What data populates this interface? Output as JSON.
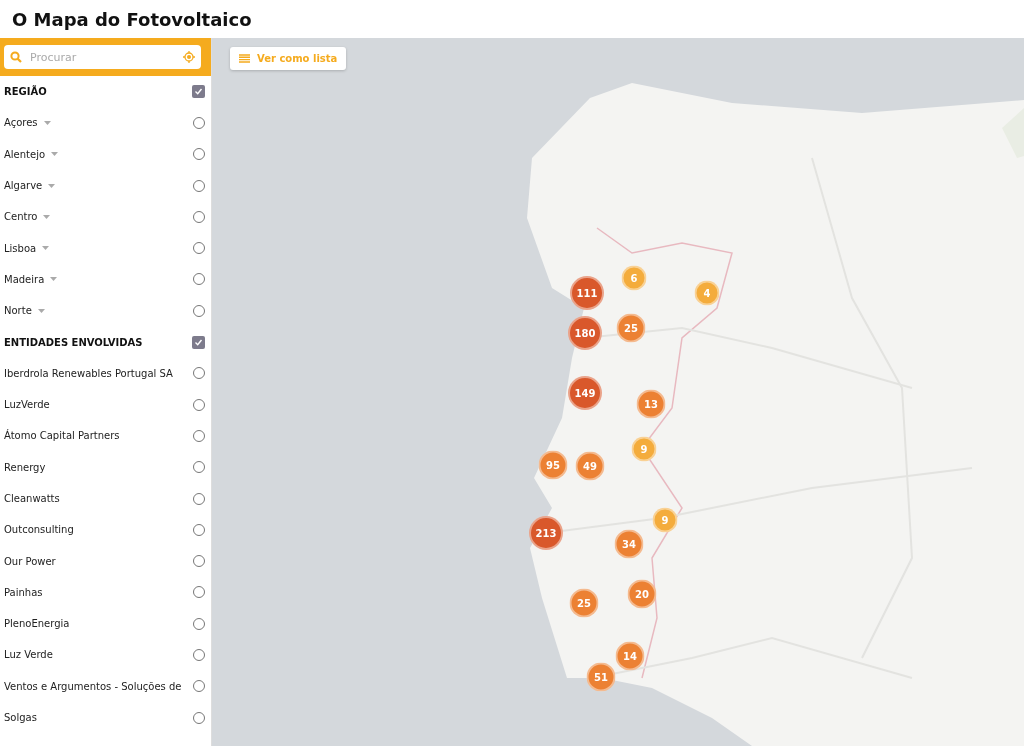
{
  "title": "O Mapa do Fotovoltaico",
  "search": {
    "placeholder": "Procurar"
  },
  "list_button": {
    "label": "Ver como lista"
  },
  "sections": [
    {
      "heading": "REGIÃO",
      "checked": true,
      "items": [
        {
          "label": "Açores",
          "expandable": true,
          "selected": false
        },
        {
          "label": "Alentejo",
          "expandable": true,
          "selected": false
        },
        {
          "label": "Algarve",
          "expandable": true,
          "selected": false
        },
        {
          "label": "Centro",
          "expandable": true,
          "selected": false
        },
        {
          "label": "Lisboa",
          "expandable": true,
          "selected": false
        },
        {
          "label": "Madeira",
          "expandable": true,
          "selected": false
        },
        {
          "label": "Norte",
          "expandable": true,
          "selected": false
        }
      ]
    },
    {
      "heading": "ENTIDADES ENVOLVIDAS",
      "checked": true,
      "items": [
        {
          "label": "Iberdrola Renewables Portugal SA",
          "expandable": false,
          "selected": false
        },
        {
          "label": "LuzVerde",
          "expandable": false,
          "selected": false
        },
        {
          "label": "Átomo Capital Partners",
          "expandable": false,
          "selected": false
        },
        {
          "label": "Renergy",
          "expandable": false,
          "selected": false
        },
        {
          "label": "Cleanwatts",
          "expandable": false,
          "selected": false
        },
        {
          "label": "Outconsulting",
          "expandable": false,
          "selected": false
        },
        {
          "label": "Our Power",
          "expandable": false,
          "selected": false
        },
        {
          "label": "Painhas",
          "expandable": false,
          "selected": false
        },
        {
          "label": "PlenoEnergia",
          "expandable": false,
          "selected": false
        },
        {
          "label": "Luz Verde",
          "expandable": false,
          "selected": false
        },
        {
          "label": "Ventos e Argumentos - Soluções de",
          "expandable": false,
          "selected": false
        },
        {
          "label": "Solgas",
          "expandable": false,
          "selected": false
        }
      ]
    }
  ],
  "clusters": [
    {
      "count": "111",
      "color": "#d9582b"
    },
    {
      "count": "6",
      "color": "#f4ac3c"
    },
    {
      "count": "4",
      "color": "#f4ac3c"
    },
    {
      "count": "180",
      "color": "#d9582b"
    },
    {
      "count": "25",
      "color": "#ec8133"
    },
    {
      "count": "149",
      "color": "#d9582b"
    },
    {
      "count": "13",
      "color": "#ec8133"
    },
    {
      "count": "9",
      "color": "#f4ac3c"
    },
    {
      "count": "95",
      "color": "#ec8133"
    },
    {
      "count": "49",
      "color": "#ec8133"
    },
    {
      "count": "9",
      "color": "#f4ac3c"
    },
    {
      "count": "213",
      "color": "#d9582b"
    },
    {
      "count": "34",
      "color": "#ec8133"
    },
    {
      "count": "20",
      "color": "#ec8133"
    },
    {
      "count": "25",
      "color": "#ec8133"
    },
    {
      "count": "14",
      "color": "#ec8133"
    },
    {
      "count": "51",
      "color": "#ec8133"
    }
  ]
}
